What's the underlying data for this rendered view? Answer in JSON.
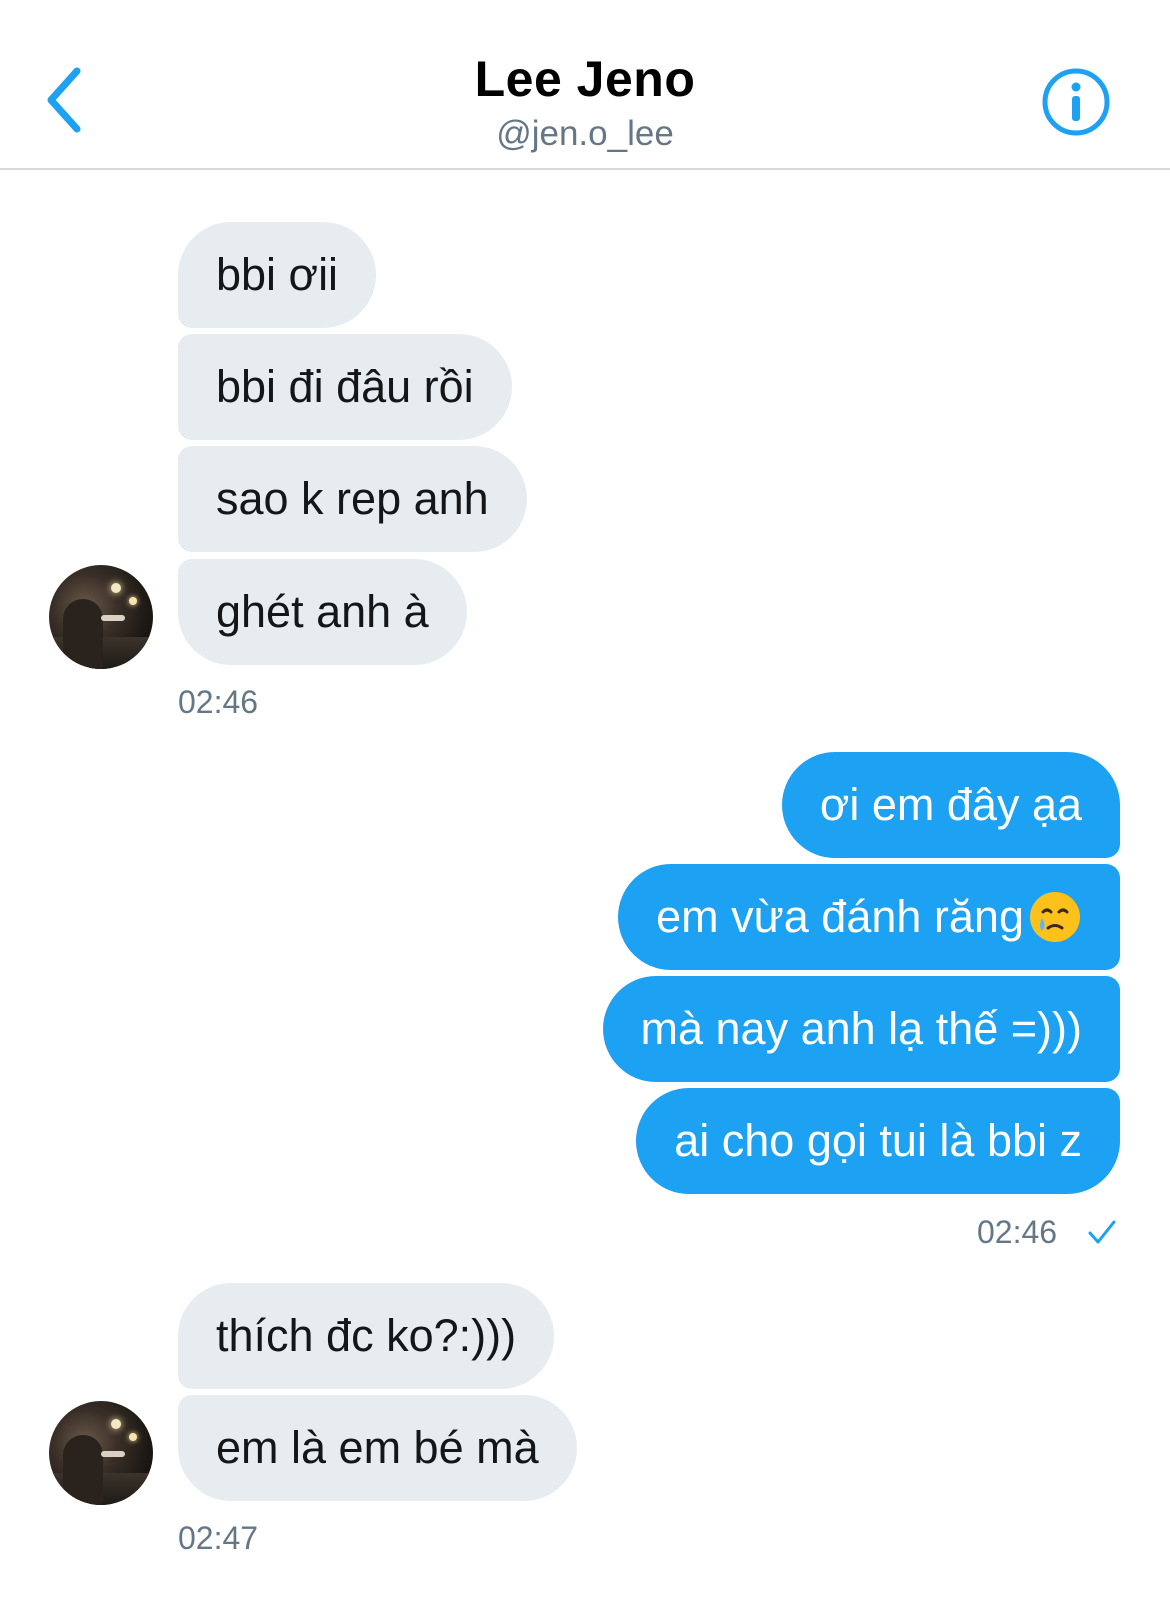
{
  "header": {
    "title": "Lee Jeno",
    "handle": "@jen.o_lee",
    "back_icon": "chevron-left-icon",
    "info_icon": "info-icon"
  },
  "colors": {
    "accent": "#1da1f2",
    "incoming_bubble": "#e6ecf0",
    "muted_text": "#657786"
  },
  "conversation": {
    "group1": {
      "messages": [
        "bbi ơii",
        "bbi đi đâu rồi",
        "sao k rep anh",
        "ghét anh à"
      ],
      "time": "02:46"
    },
    "group2": {
      "messages": [
        "ơi em đây ạa",
        "em vừa đánh răng",
        "mà nay anh lạ thế =)))",
        "ai cho gọi tui là bbi z"
      ],
      "emoji": "crying-face-emoji",
      "time": "02:46",
      "status_icon": "read-check-icon"
    },
    "group3": {
      "messages": [
        "thích đc ko?:)))",
        "em là em bé mà"
      ],
      "time": "02:47"
    }
  }
}
